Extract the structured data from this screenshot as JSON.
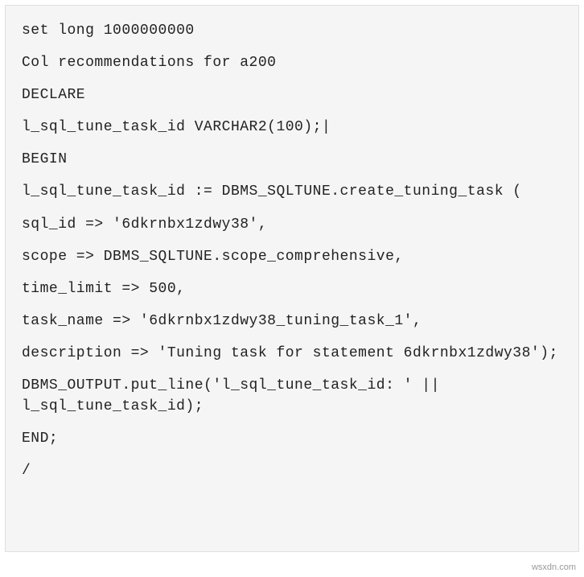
{
  "code": {
    "lines": [
      "set long 1000000000",
      "Col recommendations for a200",
      "DECLARE",
      "l_sql_tune_task_id VARCHAR2(100);|",
      "BEGIN",
      "l_sql_tune_task_id := DBMS_SQLTUNE.create_tuning_task (",
      "sql_id => '6dkrnbx1zdwy38',",
      "scope => DBMS_SQLTUNE.scope_comprehensive,",
      "time_limit => 500,",
      "task_name => '6dkrnbx1zdwy38_tuning_task_1',",
      "description => 'Tuning task for statement 6dkrnbx1zdwy38');",
      "DBMS_OUTPUT.put_line('l_sql_tune_task_id: ' || l_sql_tune_task_id);",
      "END;",
      "/"
    ]
  },
  "watermark": "wsxdn.com"
}
